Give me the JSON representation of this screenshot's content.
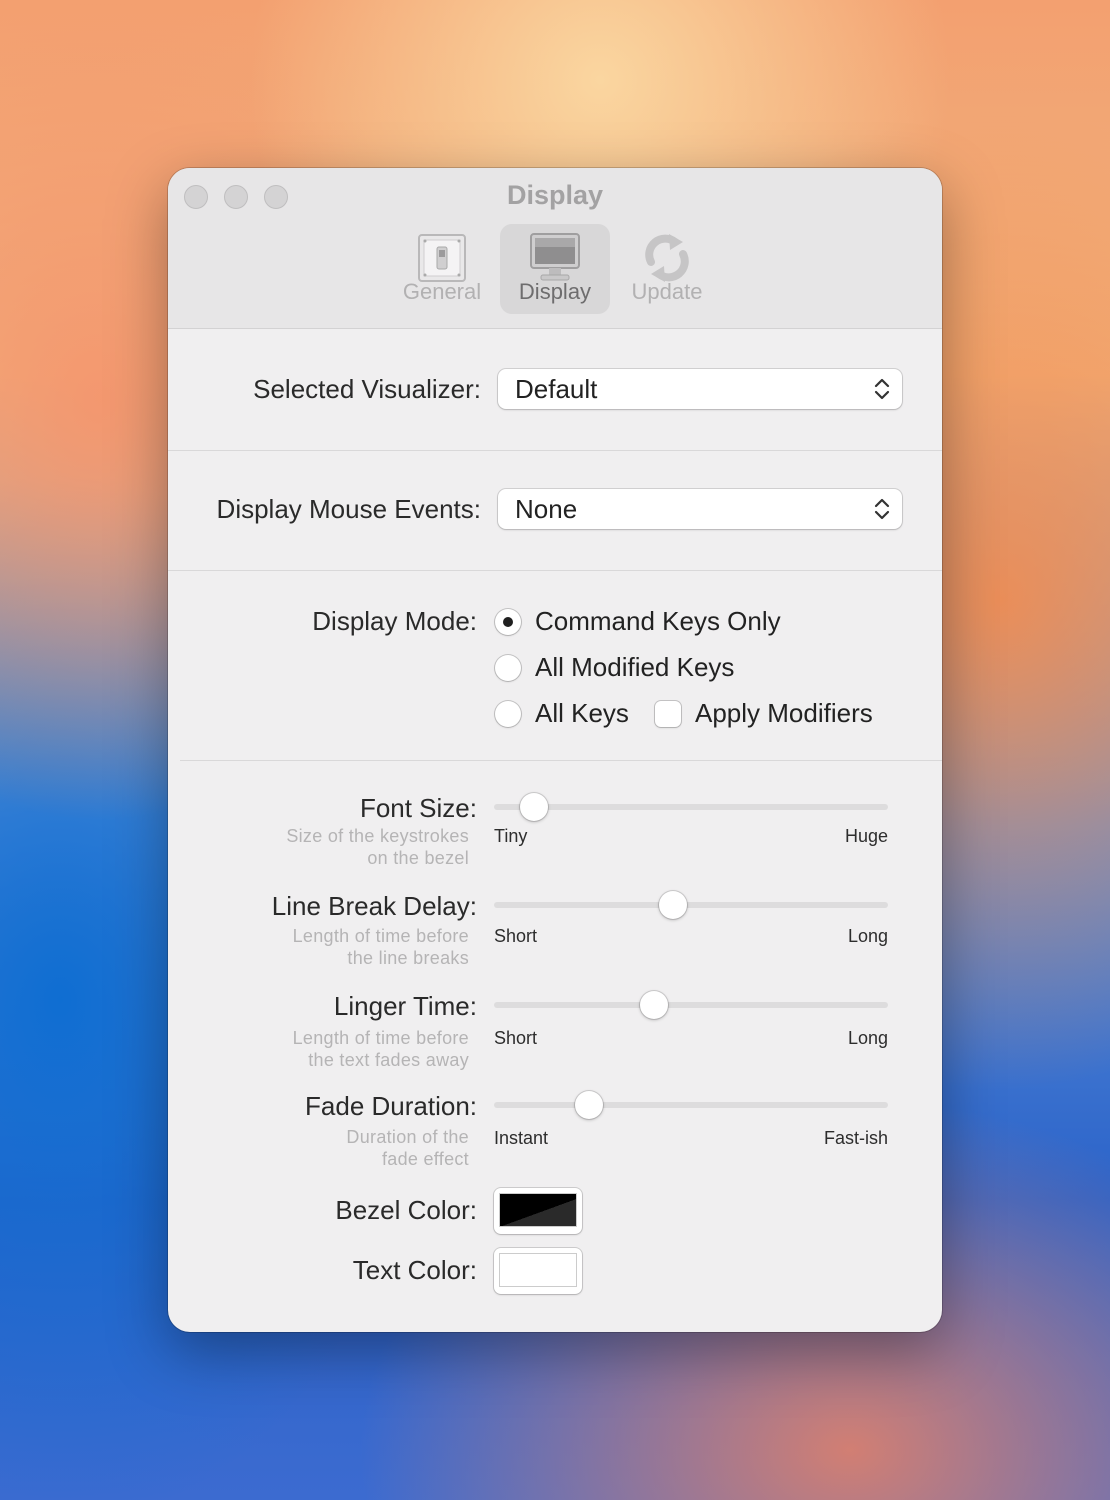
{
  "window": {
    "title": "Display"
  },
  "toolbar": {
    "tabs": [
      {
        "label": "General",
        "icon": "switch-icon"
      },
      {
        "label": "Display",
        "icon": "monitor-icon"
      },
      {
        "label": "Update",
        "icon": "refresh-icon"
      }
    ],
    "selected": "Display"
  },
  "visualizer": {
    "label": "Selected Visualizer:",
    "value": "Default"
  },
  "mouse_events": {
    "label": "Display Mouse Events:",
    "value": "None"
  },
  "display_mode": {
    "label": "Display Mode:",
    "options": [
      "Command Keys Only",
      "All Modified Keys",
      "All Keys"
    ],
    "selected": "Command Keys Only",
    "apply_modifiers": {
      "label": "Apply Modifiers",
      "checked": false
    }
  },
  "sliders": [
    {
      "label": "Font Size:",
      "sub1": "Size of the keystrokes",
      "sub2": "on the bezel",
      "min_label": "Tiny",
      "max_label": "Huge",
      "value": 0.07
    },
    {
      "label": "Line Break Delay:",
      "sub1": "Length of time before",
      "sub2": "the line breaks",
      "min_label": "Short",
      "max_label": "Long",
      "value": 0.45
    },
    {
      "label": "Linger Time:",
      "sub1": "Length of time before",
      "sub2": "the text fades away",
      "min_label": "Short",
      "max_label": "Long",
      "value": 0.4
    },
    {
      "label": "Fade Duration:",
      "sub1": "Duration of the",
      "sub2": "fade effect",
      "min_label": "Instant",
      "max_label": "Fast-ish",
      "value": 0.22
    }
  ],
  "bezel_color": {
    "label": "Bezel Color:",
    "color": "#000000"
  },
  "text_color": {
    "label": "Text Color:",
    "color": "#ffffff"
  }
}
